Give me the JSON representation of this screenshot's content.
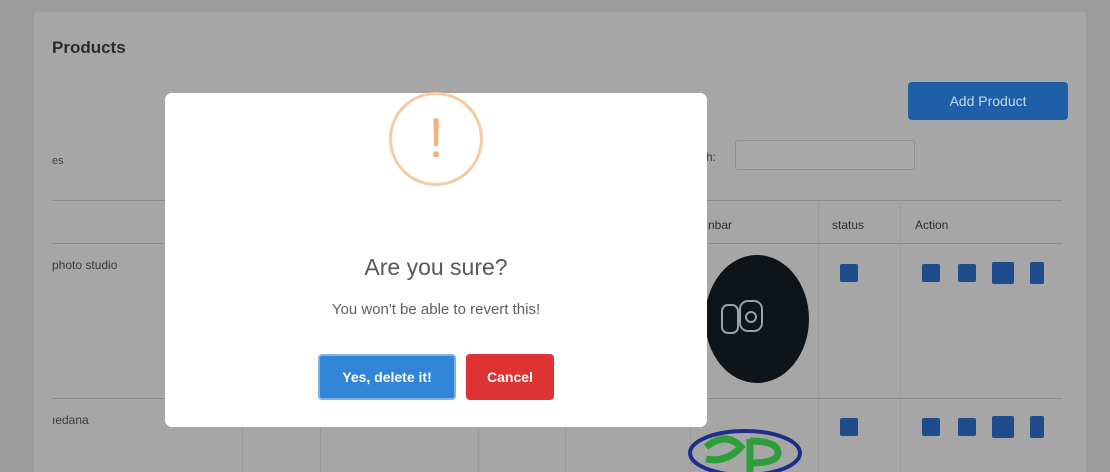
{
  "page": {
    "card_title": "Products",
    "add_button_label": "Add Product",
    "entries_label": "es",
    "search_label": "ch:",
    "search_value": ""
  },
  "table": {
    "headers": [
      "nbar",
      "status",
      "Action"
    ],
    "rows": [
      {
        "name": "photo studio"
      },
      {
        "name": "ıedana"
      }
    ]
  },
  "modal": {
    "icon": "warning-icon",
    "icon_glyph": "!",
    "title": "Are you sure?",
    "text": "You won't be able to revert this!",
    "confirm_label": "Yes, delete it!",
    "cancel_label": "Cancel"
  },
  "colors": {
    "confirm": "#3085d6",
    "cancel": "#dd3333",
    "warning": "#f5cba3",
    "primary_dark": "#1e4c8a"
  }
}
